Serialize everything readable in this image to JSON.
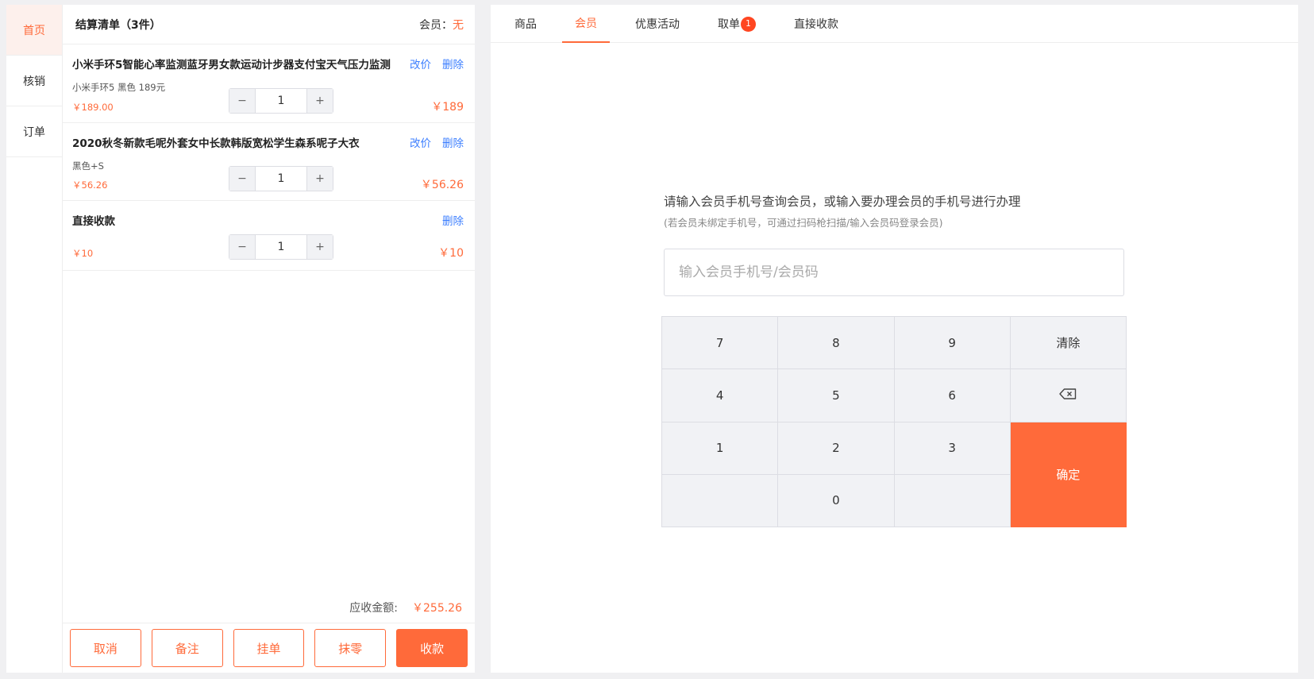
{
  "nav": {
    "items": [
      {
        "label": "首页",
        "active": true
      },
      {
        "label": "核销"
      },
      {
        "label": "订单"
      }
    ]
  },
  "cart": {
    "title": "结算清单（3件）",
    "member_label": "会员：",
    "member_value": "无",
    "items": [
      {
        "name": "小米手环5智能心率监测蓝牙男女款运动计步器支付宝天气压力监测",
        "edit_label": "改价",
        "delete_label": "删除",
        "spec": "小米手环5 黑色 189元",
        "unit_price": "￥189.00",
        "qty": "1",
        "total": "￥189"
      },
      {
        "name": "2020秋冬新款毛呢外套女中长款韩版宽松学生森系呢子大衣",
        "edit_label": "改价",
        "delete_label": "删除",
        "spec": "黑色+S",
        "unit_price": "￥56.26",
        "qty": "1",
        "total": "￥56.26"
      },
      {
        "name": "直接收款",
        "delete_label": "删除",
        "unit_price": "￥10",
        "qty": "1",
        "total": "￥10"
      }
    ],
    "stepper": {
      "minus": "−",
      "plus": "+"
    },
    "total_label": "应收金额:",
    "total_value": "￥255.26",
    "footer_buttons": {
      "cancel": "取消",
      "note": "备注",
      "hold": "挂单",
      "round": "抹零",
      "pay": "收款"
    }
  },
  "tabs": [
    {
      "label": "商品"
    },
    {
      "label": "会员",
      "active": true
    },
    {
      "label": "优惠活动"
    },
    {
      "label": "取单",
      "badge": "1"
    },
    {
      "label": "直接收款"
    }
  ],
  "member": {
    "prompt": "请输入会员手机号查询会员，或输入要办理会员的手机号进行办理",
    "hint": "(若会员未绑定手机号，可通过扫码枪扫描/输入会员码登录会员)",
    "input_placeholder": "输入会员手机号/会员码",
    "input_value": ""
  },
  "keypad": {
    "keys": [
      "7",
      "8",
      "9",
      "清除",
      "4",
      "5",
      "6",
      "1",
      "2",
      "3",
      "0"
    ],
    "backspace_icon": "backspace-icon",
    "confirm": "确定"
  },
  "colors": {
    "accent": "#ff6a3a",
    "link": "#3d7fff",
    "badge": "#ff4621"
  }
}
